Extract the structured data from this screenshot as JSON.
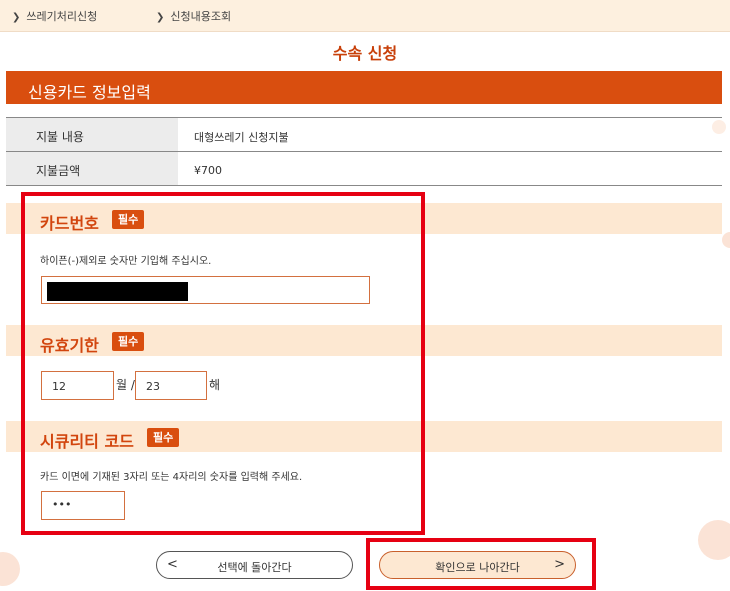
{
  "breadcrumb": [
    {
      "label": "쓰레기처리신청"
    },
    {
      "label": "신청내용조회"
    }
  ],
  "page_title": "수속 신청",
  "section_title": "신용카드 정보입력",
  "payment": {
    "rows": [
      {
        "label": "지불 내용",
        "value": "대형쓰레기 신청지불"
      },
      {
        "label": "지불금액",
        "value": "¥700"
      }
    ]
  },
  "card_number": {
    "title": "카드번호",
    "badge": "필수",
    "hint": "하이픈(-)제외로 숫자만 기입해 주십시오."
  },
  "expiry": {
    "title": "유효기한",
    "badge": "필수",
    "month_value": "12",
    "month_unit": "월 /",
    "year_value": "23",
    "year_unit": "해"
  },
  "security_code": {
    "title": "시큐리티 코드",
    "badge": "필수",
    "hint": "카드 이면에 기재된 3자리 또는 4자리의 숫자를 입력해 주세요.",
    "value": "•••"
  },
  "buttons": {
    "back_label": "선택에 돌아간다",
    "back_arrow": "<",
    "next_label": "확인으로 나아간다",
    "next_arrow": ">"
  },
  "colors": {
    "accent": "#d94e0f",
    "band": "#fde8d2",
    "highlight_frame": "#e60012"
  }
}
